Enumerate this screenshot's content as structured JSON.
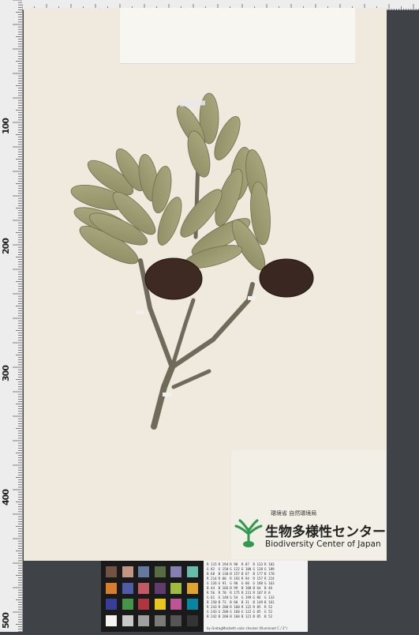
{
  "ruler": {
    "labels": [
      "100",
      "200",
      "300",
      "400",
      "500"
    ]
  },
  "label": {
    "ministry": "環境省 自然環境局",
    "center_jp": "生物多様性センター",
    "center_en": "Biodiversity Center of Japan"
  },
  "colors": {
    "sheet": "#efeadd",
    "leaf": "#9c9a72",
    "fruit": "#3e2a22",
    "logo_green": "#2f9a4c"
  },
  "card_footer": "by GretagMacbeth color checker (Illuminant C / 2°)",
  "card_rows": [
    [
      "R 115",
      "R 194",
      "R 98",
      "R 87",
      "R 133",
      "R 103"
    ],
    [
      "G 82",
      "G 150",
      "G 122",
      "G 108",
      "G 128",
      "G 189"
    ],
    [
      "B 68",
      "B 130",
      "B 157",
      "B 67",
      "B 177",
      "B 170"
    ],
    [
      "R 214",
      "R 80",
      "R 193",
      "R 94",
      "R 157",
      "R 224"
    ],
    [
      "G 126",
      "G 91",
      "G 90",
      "G 60",
      "G 188",
      "G 163"
    ],
    [
      "B 44",
      "B 166",
      "B 99",
      "B 108",
      "B 64",
      "B 46"
    ],
    [
      "R 56",
      "R 70",
      "R 175",
      "R 231",
      "R 187",
      "R 8"
    ],
    [
      "G 61",
      "G 148",
      "G 54",
      "G 199",
      "G 86",
      "G 133"
    ],
    [
      "B 150",
      "B 73",
      "B 60",
      "B 31",
      "B 149",
      "B 161"
    ],
    [
      "R 243",
      "R 200",
      "R 160",
      "R 122",
      "R 85",
      "R 52"
    ],
    [
      "G 243",
      "G 200",
      "G 160",
      "G 122",
      "G 85",
      "G 52"
    ],
    [
      "B 242",
      "B 200",
      "B 160",
      "B 121",
      "B 85",
      "B 52"
    ]
  ]
}
